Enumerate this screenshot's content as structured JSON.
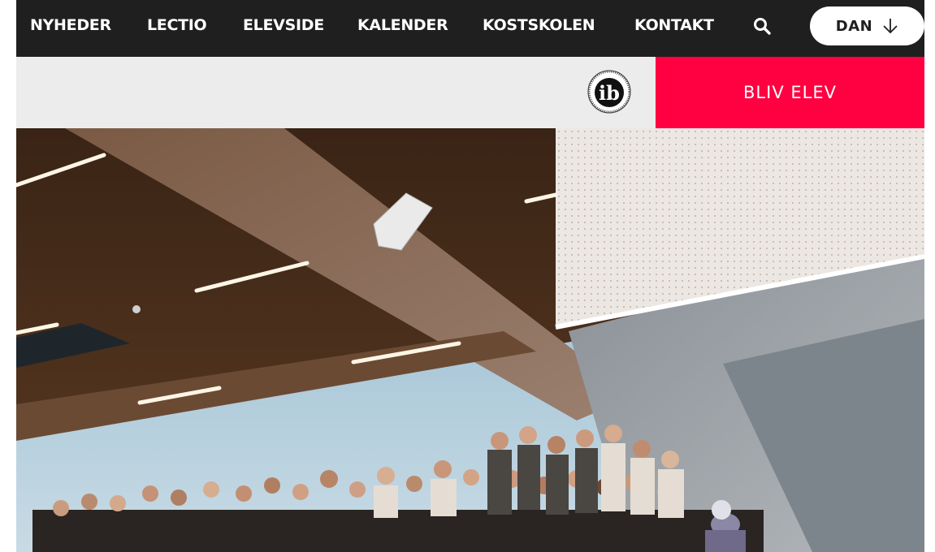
{
  "nav": {
    "items": [
      {
        "label": "NYHEDER"
      },
      {
        "label": "LECTIO"
      },
      {
        "label": "ELEVSIDE"
      },
      {
        "label": "KALENDER"
      },
      {
        "label": "KOSTSKOLEN"
      },
      {
        "label": "KONTAKT"
      }
    ],
    "search_icon": "search-icon",
    "language": {
      "label": "DAN",
      "icon": "arrow-down-icon"
    }
  },
  "subbar": {
    "logo_icon": "ib-logo",
    "cta_label": "BLIV ELEV"
  },
  "colors": {
    "nav_bg": "#1f1f1f",
    "subbar_bg": "#ececec",
    "cta_bg": "#ff0040"
  }
}
